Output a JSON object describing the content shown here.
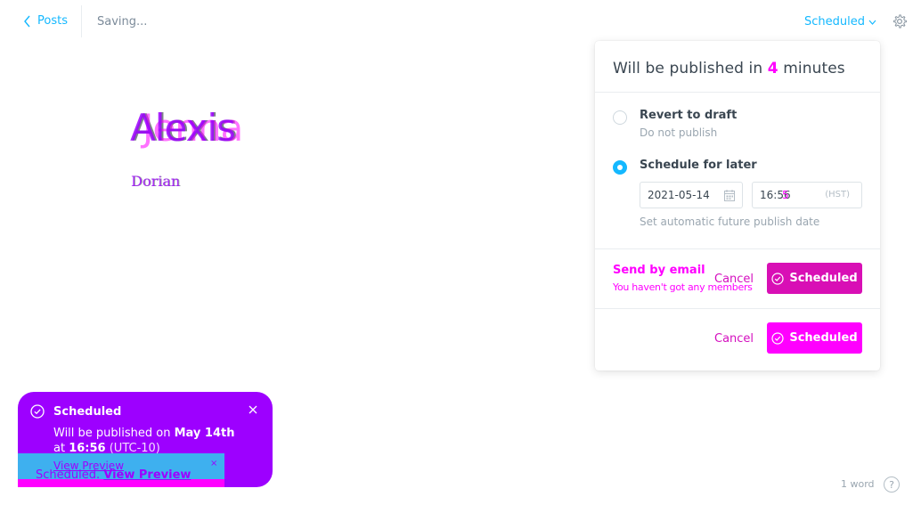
{
  "header": {
    "back_label": "Posts",
    "saving_text": "Saving...",
    "status_label": "Scheduled"
  },
  "editor": {
    "title_layers": [
      "Alexis",
      "Alexis",
      "Jenna"
    ],
    "body_layers": [
      "Dorian",
      "Dorian"
    ],
    "word_count": "1 word",
    "help_symbol": "?"
  },
  "publish_menu": {
    "heading_prefix": "Will be published in ",
    "heading_number": "4",
    "heading_suffix": " minutes",
    "options": [
      {
        "title": "Revert to draft",
        "subtitle": "Do not publish",
        "selected": false
      },
      {
        "title": "Schedule for later",
        "subtitle": "Set automatic future publish date",
        "selected": true
      }
    ],
    "date_value": "2021-05-14",
    "time_value": "16:56",
    "time_overlay": "5",
    "timezone": "(HST)",
    "email_title": "Send by email",
    "email_subtitle": "You haven't got any members",
    "cancel_label": "Cancel",
    "scheduled_label": "Scheduled",
    "footer_cancel_label": "Cancel",
    "footer_scheduled_label": "Scheduled"
  },
  "notification": {
    "title": "Scheduled",
    "message_prefix": "Will be published on ",
    "message_date": "May 14th",
    "message_at": "at ",
    "message_time": "16:56",
    "message_tz": " (UTC-10)"
  },
  "toast": {
    "ghost_link": "View Preview",
    "prefix": "Scheduled. ",
    "link": "View Preview",
    "close_symbol": "×"
  },
  "colors": {
    "accent_blue": "#14b8ff",
    "magenta": "#ff00ff",
    "purple": "#9d00ff",
    "toast_blue": "#3eb0ef"
  }
}
